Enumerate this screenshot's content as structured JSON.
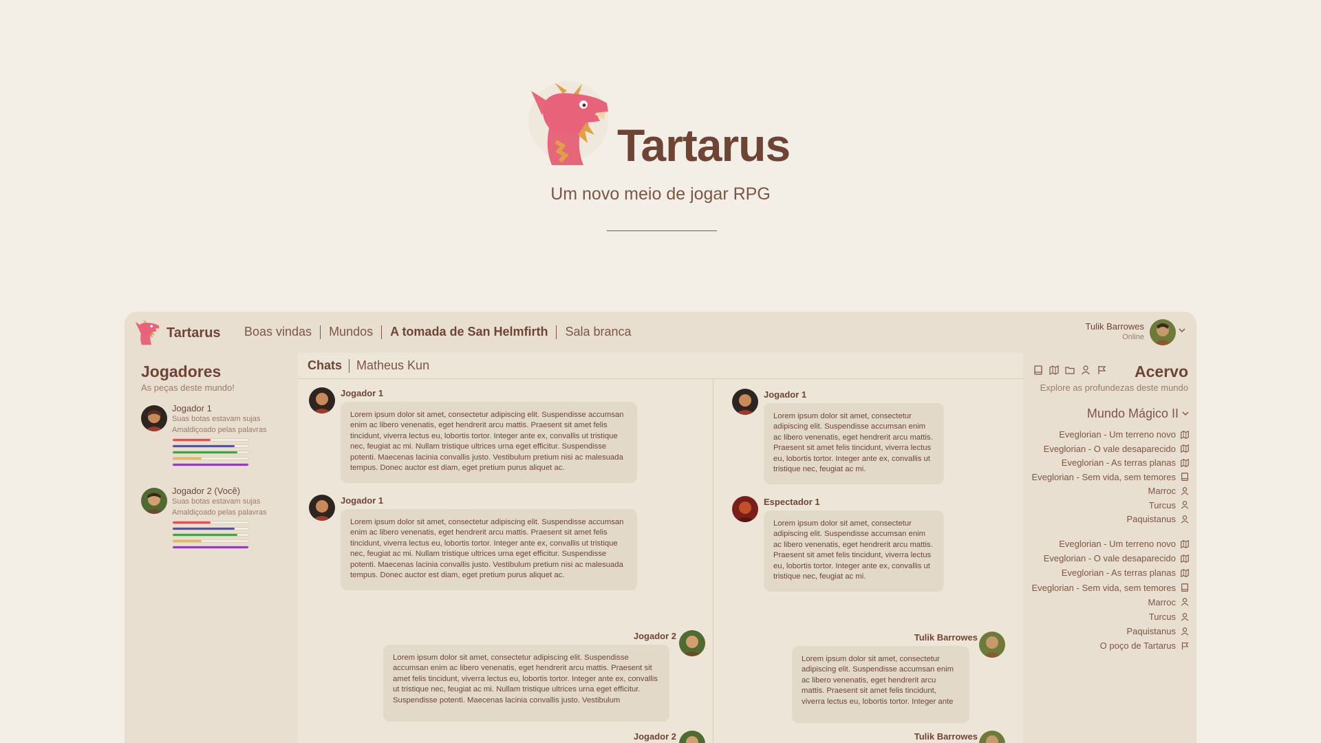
{
  "hero": {
    "title": "Tartarus",
    "subtitle": "Um novo meio de jogar RPG"
  },
  "app": {
    "brand": "Tartarus",
    "nav": [
      {
        "label": "Boas vindas",
        "active": false
      },
      {
        "label": "Mundos",
        "active": false
      },
      {
        "label": "A tomada de San Helmfirth",
        "active": true
      },
      {
        "label": "Sala branca",
        "active": false
      }
    ],
    "user": {
      "name": "Tulik Barrowes",
      "status": "Online"
    }
  },
  "players": {
    "title": "Jogadores",
    "subtitle": "As peças deste mundo!",
    "items": [
      {
        "name": "Jogador 1",
        "note1": "Suas botas estavam sujas",
        "note2": "Amaldiçoado pelas palavras",
        "bars": [
          0.5,
          0.82,
          0.85,
          0.38,
          1.0
        ]
      },
      {
        "name": "Jogador 2 (Você)",
        "note1": "Suas botas estavam sujas",
        "note2": "Amaldiçoado pelas palavras",
        "bars": [
          0.5,
          0.82,
          0.85,
          0.38,
          1.0
        ]
      }
    ],
    "bar_colors": [
      "#e05050",
      "#4a4fcf",
      "#47a047",
      "#f0b73a",
      "#8f3fb8"
    ]
  },
  "chats": {
    "tabs": [
      {
        "label": "Chats",
        "active": true
      },
      {
        "label": "Matheus Kun",
        "active": false
      }
    ],
    "left_column": [
      {
        "author": "Jogador 1",
        "text": "Lorem ipsum dolor sit amet, consectetur adipiscing elit. Suspendisse accumsan enim ac libero venenatis, eget hendrerit arcu mattis. Praesent sit amet felis tincidunt, viverra lectus eu, lobortis tortor. Integer ante ex, convallis ut tristique nec, feugiat ac mi. Nullam tristique ultrices urna eget efficitur. Suspendisse potenti. Maecenas lacinia convallis justo. Vestibulum pretium nisi ac malesuada tempus. Donec auctor est diam, eget pretium purus aliquet ac."
      },
      {
        "author": "Jogador 1",
        "text": "Lorem ipsum dolor sit amet, consectetur adipiscing elit. Suspendisse accumsan enim ac libero venenatis, eget hendrerit arcu mattis. Praesent sit amet felis tincidunt, viverra lectus eu, lobortis tortor. Integer ante ex, convallis ut tristique nec, feugiat ac mi. Nullam tristique ultrices urna eget efficitur. Suspendisse potenti. Maecenas lacinia convallis justo. Vestibulum pretium nisi ac malesuada tempus. Donec auctor est diam, eget pretium purus aliquet ac."
      },
      {
        "author": "Jogador 2",
        "text": "Lorem ipsum dolor sit amet, consectetur adipiscing elit. Suspendisse accumsan enim ac libero venenatis, eget hendrerit arcu mattis. Praesent sit amet felis tincidunt, viverra lectus eu, lobortis tortor. Integer ante ex, convallis ut tristique nec, feugiat ac mi. Nullam tristique ultrices urna eget efficitur. Suspendisse potenti. Maecenas lacinia convallis justo. Vestibulum"
      },
      {
        "author": "Jogador 2",
        "text": ""
      }
    ],
    "right_column": [
      {
        "author": "Jogador 1",
        "text": "Lorem ipsum dolor sit amet, consectetur adipiscing elit. Suspendisse accumsan enim ac libero venenatis, eget hendrerit arcu mattis. Praesent sit amet felis tincidunt, viverra lectus eu, lobortis tortor. Integer ante ex, convallis ut tristique nec, feugiat ac mi."
      },
      {
        "author": "Espectador 1",
        "text": "Lorem ipsum dolor sit amet, consectetur adipiscing elit. Suspendisse accumsan enim ac libero venenatis, eget hendrerit arcu mattis. Praesent sit amet felis tincidunt, viverra lectus eu, lobortis tortor. Integer ante ex, convallis ut tristique nec, feugiat ac mi."
      },
      {
        "author": "Tulik Barrowes",
        "text": "Lorem ipsum dolor sit amet, consectetur adipiscing elit. Suspendisse accumsan enim ac libero venenatis, eget hendrerit arcu mattis. Praesent sit amet felis tincidunt, viverra lectus eu, lobortis tortor. Integer ante"
      },
      {
        "author": "Tulik Barrowes",
        "text": ""
      }
    ]
  },
  "library": {
    "title": "Acervo",
    "subtitle": "Explore as profundezas deste mundo",
    "world": "Mundo Mágico II",
    "group1": [
      {
        "label": "Eveglorian - Um terreno novo",
        "icon": "map-icon"
      },
      {
        "label": "Eveglorian - O vale desaparecido",
        "icon": "map-icon"
      },
      {
        "label": "Eveglorian - As terras planas",
        "icon": "map-icon"
      },
      {
        "label": "Eveglorian  - Sem vida, sem temores",
        "icon": "book-icon"
      },
      {
        "label": "Marroc",
        "icon": "person-icon"
      },
      {
        "label": "Turcus",
        "icon": "person-icon"
      },
      {
        "label": "Paquistanus",
        "icon": "person-icon"
      }
    ],
    "group2": [
      {
        "label": "Eveglorian - Um terreno novo",
        "icon": "map-icon"
      },
      {
        "label": "Eveglorian - O vale desaparecido",
        "icon": "map-icon"
      },
      {
        "label": "Eveglorian - As terras planas",
        "icon": "map-icon"
      },
      {
        "label": "Eveglorian  - Sem vida, sem temores",
        "icon": "book-icon"
      },
      {
        "label": "Marroc",
        "icon": "person-icon"
      },
      {
        "label": "Turcus",
        "icon": "person-icon"
      },
      {
        "label": "Paquistanus",
        "icon": "person-icon"
      },
      {
        "label": "O poço de Tartarus",
        "icon": "flag-icon"
      }
    ]
  }
}
